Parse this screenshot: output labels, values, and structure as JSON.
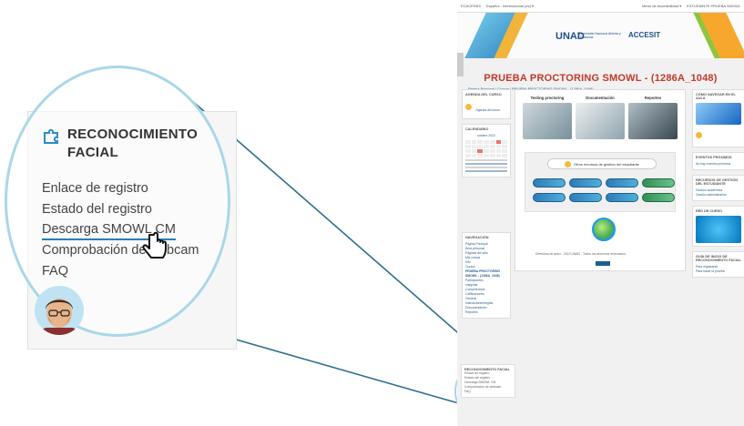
{
  "zoom_panel": {
    "title": "RECONOCIMIENTO FACIAL",
    "links": [
      "Enlace de registro",
      "Estado del registro",
      "Descarga SMOWL CM",
      "Comprobación de webcam",
      "FAQ"
    ]
  },
  "site": {
    "topbar": {
      "left": "ECACENSS",
      "lang": "Español - Internacional (es) ▾",
      "accessibility": "Menú de Accesibilidad ▾",
      "user": "ESTUDIANTE PRUEBA SMOWL"
    },
    "banner": {
      "unad": "UNAD",
      "unad_sub": "Universidad Nacional Abierta y a Distancia",
      "accesit": "ACCESIT"
    },
    "course_title": "PRUEBA PROCTORING SMOWL - (1286A_1048)",
    "breadcrumb": "Página Principal / Cursos / PRUEBA PROCTORING SMOWL - (1286A_1048)",
    "left_blocks": {
      "agenda_title": "AGENDA DEL CURSO",
      "agenda_label": "Agenda del curso",
      "calendar_title": "CALENDARIO",
      "calendar_month": "octubre 2022",
      "navigation_title": "NAVEGACIÓN",
      "navigation_items": [
        "Página Principal",
        "Área personal",
        "Páginas del sitio",
        "Mis cursos",
        "Info",
        "Cursos",
        "PRUEBA PROCTORING SMOWL - (1286A_1048)",
        "Participantes",
        "Insignias",
        "Competencias",
        "Calificaciones",
        "General",
        "Instrucciones/reglas",
        "Documentación",
        "Reportes"
      ]
    },
    "facial_block": {
      "title": "RECONOCIMIENTO FACIAL",
      "links": [
        "Enlace de registro",
        "Estado del registro",
        "Descarga SMOWL CM",
        "Comprobación de webcam",
        "FAQ"
      ]
    },
    "main": {
      "tiles": [
        "Testing proctoring",
        "Documentación",
        "Reportes"
      ],
      "resources_label": "Otros recursos de gestión del estudiante",
      "footer": "Derechos de autor - 2022 UNAD - Todos los derechos reservados."
    },
    "right_blocks": {
      "howto_title": "CÓMO NAVEGAR EN EL AULA",
      "events_title": "EVENTOS PRÓXIMOS",
      "events_text": "No hay eventos próximos",
      "resources_title": "RECURSOS DE GESTIÓN DEL ESTUDIANTE",
      "resources_a": "Gestión académica",
      "resources_b": "Gestión administrativa",
      "web_title": "RED DE CURSO",
      "guide_title": "GUÍA DE INICIO DE RECONOCIMIENTO FACIAL",
      "guide_a": "Para registrarse",
      "guide_b": "Para hacer la prueba"
    }
  }
}
